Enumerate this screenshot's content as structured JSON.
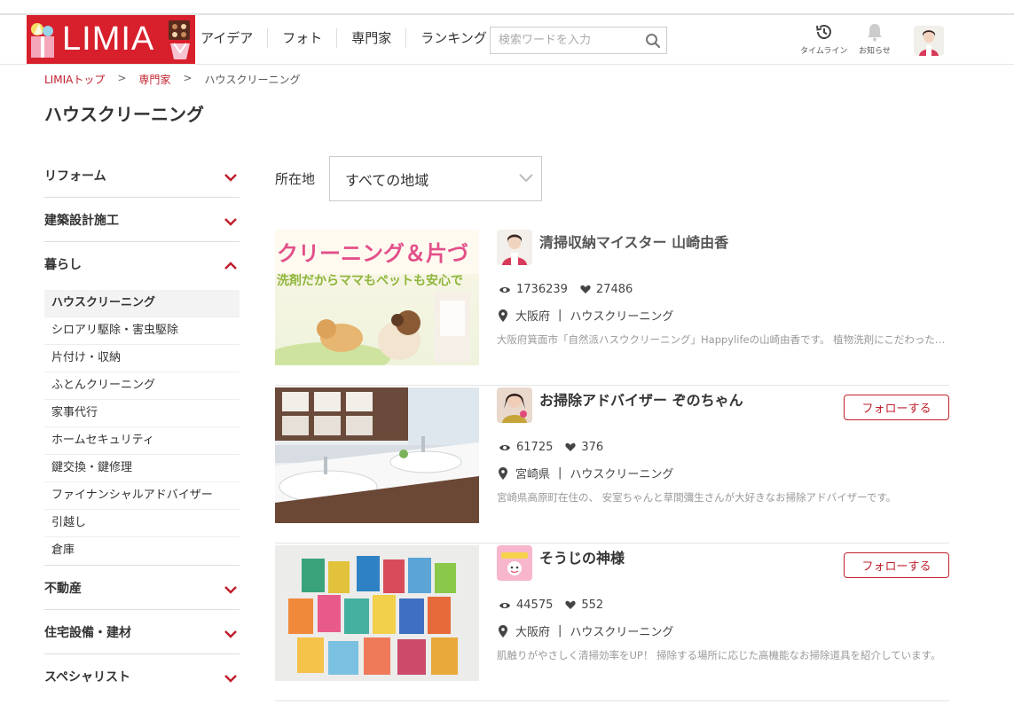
{
  "header": {
    "logo_text": "LIMIA",
    "nav": [
      "アイデア",
      "フォト",
      "専門家",
      "ランキング"
    ],
    "search_placeholder": "検索ワードを入力",
    "timeline_label": "タイムライン",
    "notice_label": "お知らせ"
  },
  "breadcrumb": {
    "items": [
      "LIMIAトップ",
      "専門家"
    ],
    "separator": ">",
    "current": "ハウスクリーニング"
  },
  "page_title": "ハウスクリーニング",
  "sidebar": {
    "categories_before": [
      "リフォーム",
      "建築設計施工"
    ],
    "open_category": "暮らし",
    "subitems": [
      "ハウスクリーニング",
      "シロアリ駆除・害虫駆除",
      "片付け・収納",
      "ふとんクリーニング",
      "家事代行",
      "ホームセキュリティ",
      "鍵交換・鍵修理",
      "ファイナンシャルアドバイザー",
      "引越し",
      "倉庫"
    ],
    "categories_after": [
      "不動産",
      "住宅設備・建材",
      "スペシャリスト"
    ]
  },
  "filter": {
    "label": "所在地",
    "selected": "すべての地域"
  },
  "cards": [
    {
      "name": "清掃収納マイスター 山崎由香",
      "views": "1736239",
      "likes": "27486",
      "prefecture": "大阪府",
      "category": "ハウスクリーニング",
      "description": "大阪府箕面市「自然派ハスウクリーニング」Happylifeの山崎由香です。 植物洗剤にこだわったハウスクリーニングを行っています。",
      "banner_line1": "クリーニング＆片づ",
      "banner_line2": "洗剤だからママもペットも安心で",
      "follow": null
    },
    {
      "name": "お掃除アドバイザー ぞのちゃん",
      "views": "61725",
      "likes": "376",
      "prefecture": "宮崎県",
      "category": "ハウスクリーニング",
      "description": "宮崎県高原町在住の、 安室ちゃんと草間彌生さんが大好きなお掃除アドバイザーです。",
      "follow": "フォローする"
    },
    {
      "name": "そうじの神様",
      "views": "44575",
      "likes": "552",
      "prefecture": "大阪府",
      "category": "ハウスクリーニング",
      "description": "肌触りがやさしく清掃効率をUP！ 掃除する場所に応じた高機能なお掃除道具を紹介しています。",
      "follow": "フォローする"
    }
  ],
  "colors": {
    "brand_red": "#d81f2c",
    "link_red": "#c11f2c"
  }
}
